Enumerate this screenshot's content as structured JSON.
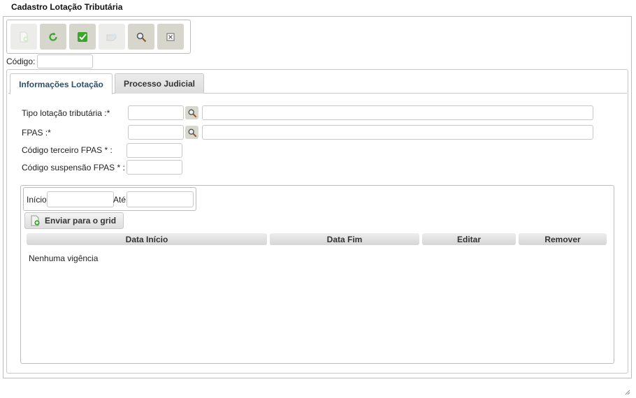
{
  "window": {
    "title": "Cadastro Lotação Tributária"
  },
  "toolbar": {
    "buttons": [
      {
        "icon": "new-document-icon",
        "enabled": false
      },
      {
        "icon": "refresh-icon",
        "enabled": true
      },
      {
        "icon": "save-check-icon",
        "enabled": true
      },
      {
        "icon": "delete-icon",
        "enabled": false
      },
      {
        "icon": "search-icon",
        "enabled": true
      },
      {
        "icon": "close-icon",
        "enabled": true
      }
    ]
  },
  "codigo": {
    "label": "Código:",
    "value": ""
  },
  "tabs": [
    {
      "label": "Informações Lotação",
      "active": true
    },
    {
      "label": "Processo Judicial",
      "active": false
    }
  ],
  "form": {
    "tipo_lotacao_label": "Tipo lotação tributária :*",
    "fpas_label": "FPAS :*",
    "codigo_terceiro_label": "Código terceiro FPAS * :",
    "codigo_suspensao_label": "Código suspensão FPAS * :"
  },
  "vigencia": {
    "inicio_label": "Início",
    "ate_label": "Até",
    "send_button": "Enviar para o grid",
    "columns": [
      "Data Início",
      "Data Fim",
      "Editar",
      "Remover"
    ],
    "empty_message": "Nenhuma vigência"
  },
  "colors": {
    "toolbar_button": "#d6d6cd",
    "active_tab_text": "#2c4f6b",
    "icon_green": "#3aa52a"
  }
}
